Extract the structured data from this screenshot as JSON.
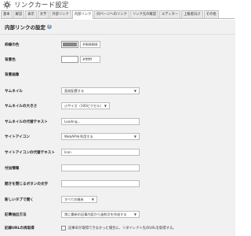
{
  "header": {
    "title": "リンクカード設定",
    "icon": "gear-icon"
  },
  "tabs": [
    {
      "label": "基本",
      "active": false
    },
    {
      "label": "解説",
      "active": false
    },
    {
      "label": "表示",
      "active": false
    },
    {
      "label": "文字",
      "active": false
    },
    {
      "label": "外部リンク",
      "active": false
    },
    {
      "label": "内部リンク",
      "active": true
    },
    {
      "label": "同ページへのリンク",
      "active": false
    },
    {
      "label": "リンク先の確認",
      "active": false
    },
    {
      "label": "エディター",
      "active": false
    },
    {
      "label": "上級者向け",
      "active": false
    },
    {
      "label": "その他",
      "active": false
    }
  ],
  "section": {
    "title": "内部リンクの設定",
    "help": "?"
  },
  "fields": {
    "border_color": {
      "label": "枠線の色",
      "value": "#888888",
      "swatch": "#888888"
    },
    "background_color": {
      "label": "背景色",
      "value": "#ffffff",
      "swatch": "#ffffff"
    },
    "background_image": {
      "label": "背景画像",
      "value": ""
    },
    "thumbnail": {
      "label": "サムネイル",
      "value": "直前配置する"
    },
    "thumbnail_size": {
      "label": "サムネイルの大きさ",
      "value": "小サイズ（100ピクセル）"
    },
    "thumbnail_alt_text": {
      "label": "サムネイルの代替テキスト",
      "value": "Loading..."
    },
    "site_icon": {
      "label": "サイトアイコン",
      "value": "WebAPIを利用する"
    },
    "site_icon_alt_text": {
      "label": "サイトアイコンの代替テキスト",
      "value": "Icon"
    },
    "attached_info": {
      "label": "付加情報",
      "value": ""
    },
    "close_button_text": {
      "label": "開きを閉じるボタンの文字",
      "value": ""
    },
    "open_new_tab": {
      "label": "新しいタブで開く",
      "value": "すべての端末"
    },
    "excerpt_method": {
      "label": "記事抽出方法",
      "value": "常に最新の記事内容から抜粋文を作成する"
    },
    "record_url": {
      "label": "記録URLの再取得",
      "checkbox_text": "記事IDが取得できなかった場合に、リダイレクト先のURLを取得する。"
    }
  }
}
